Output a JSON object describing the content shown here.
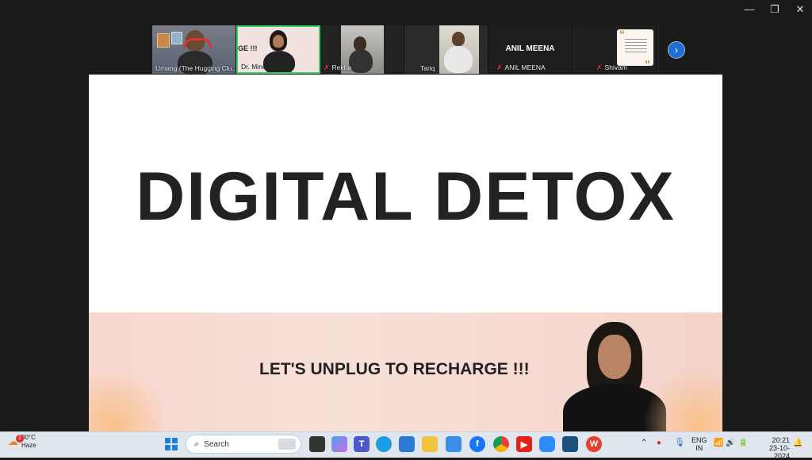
{
  "window_controls": {
    "minimize": "—",
    "restore": "❐",
    "close": "✕"
  },
  "participants": [
    {
      "name": "Umang (The Hugging Clu...",
      "muted": false
    },
    {
      "name": "Dr. Minoli  Doshi",
      "muted": false,
      "shared_text": "GE !!!",
      "active_speaker": true
    },
    {
      "name": "Rekha",
      "muted": true
    },
    {
      "name": "Tariq",
      "muted": false
    },
    {
      "name": "ANIL MEENA",
      "muted": true,
      "banner": "ANIL MEENA"
    },
    {
      "name": "Shivam",
      "muted": true
    }
  ],
  "strip": {
    "next_label": "›"
  },
  "slide": {
    "title": "DIGITAL DETOX",
    "subtitle": "LET'S UNPLUG TO RECHARGE !!!"
  },
  "taskbar": {
    "weather_temp": "30°C",
    "weather_desc": "Haze",
    "weather_badge": "1",
    "search_placeholder": "Search",
    "lang_1": "ENG",
    "lang_2": "IN",
    "time": "20:21",
    "date": "23-10-2024"
  },
  "colors": {
    "accent": "#1e6ed8",
    "active_border": "#3ad166",
    "slide_bg": "#ffffff",
    "banner_bg": "#f6d7cf"
  }
}
